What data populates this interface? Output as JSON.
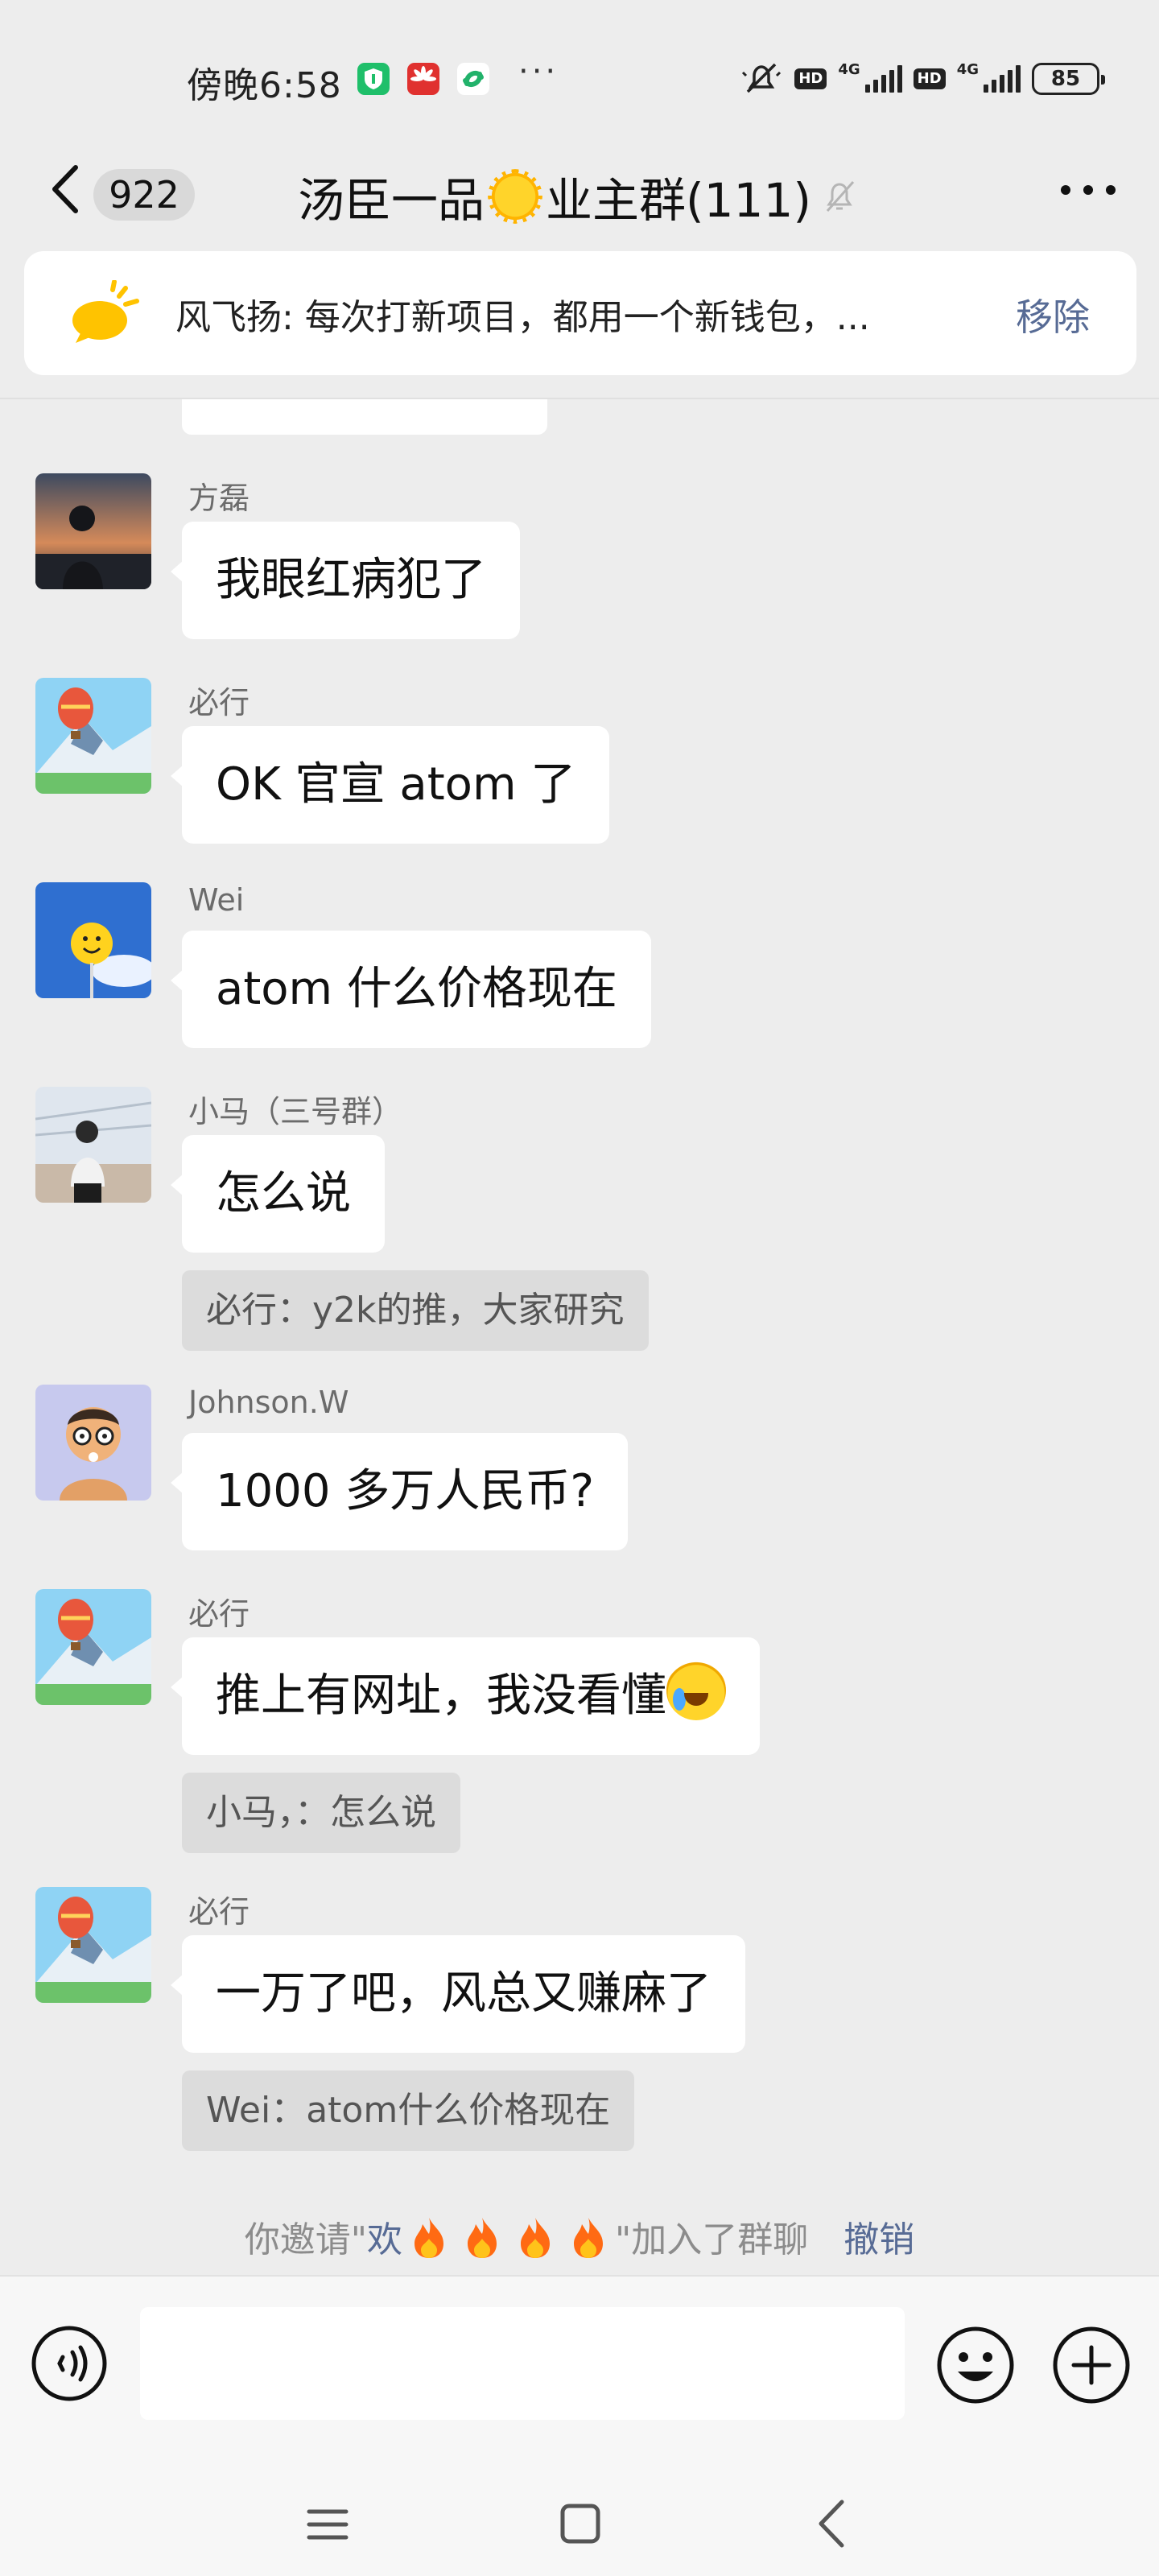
{
  "status_bar": {
    "time": "傍晚6:58",
    "more": "···",
    "hd_badges": [
      "HD",
      "HD"
    ],
    "networks": [
      "4G",
      "4G"
    ],
    "battery": "85"
  },
  "header": {
    "unread_count": "922",
    "title_prefix": "汤臣一品",
    "title_suffix": "业主群(111)"
  },
  "notice": {
    "text": "风飞扬: 每次打新项目，都用一个新钱包，...",
    "remove_label": "移除"
  },
  "messages": [
    {
      "sender": "方磊",
      "text": "我眼红病犯了"
    },
    {
      "sender": "必行",
      "text": "OK 官宣 atom 了"
    },
    {
      "sender": "Wei",
      "text": "atom 什么价格现在"
    },
    {
      "sender": "小马（三号群）",
      "text": "怎么说",
      "quote": "必行：y2k的推，大家研究"
    },
    {
      "sender": "Johnson.W",
      "text": "1000 多万人民币?"
    },
    {
      "sender": "必行",
      "text": "推上有网址，我没看懂",
      "quote": "小马，：怎么说"
    },
    {
      "sender": "必行",
      "text": "一万了吧，风总又赚麻了",
      "quote": "Wei：atom什么价格现在"
    }
  ],
  "system_message": {
    "prefix": "你邀请\"",
    "invitee_name": "欢",
    "suffix": "\"加入了群聊",
    "undo_label": "撤销"
  },
  "input_bar": {
    "placeholder": ""
  },
  "icons": {
    "back": "chevron-left-icon",
    "mute": "bell-off-icon",
    "more": "more-horizontal-icon",
    "notice": "megaphone-icon",
    "voice": "voice-icon",
    "emoji": "smiley-icon",
    "plus": "plus-circle-icon",
    "fire": "fire-emoji"
  },
  "colors": {
    "background": "#ededed",
    "link": "#576b95",
    "bubble": "#ffffff",
    "quote_bg": "#dcdcdc"
  }
}
